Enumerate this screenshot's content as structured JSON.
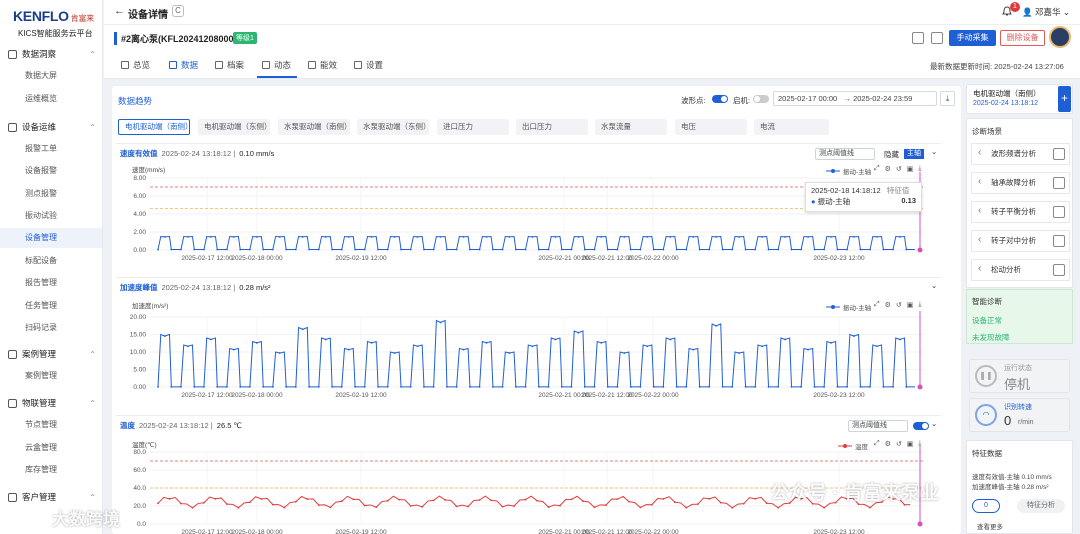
{
  "brand": {
    "logo": "KENFLO",
    "logo_cn": "肯富来",
    "platform": "KICS智能服务云平台"
  },
  "sidebar": {
    "groups": [
      {
        "label": "数据洞察",
        "items": [
          "数据大屏",
          "运维概览"
        ]
      },
      {
        "label": "设备运维",
        "items": [
          "报警工单",
          "设备报警",
          "测点报警",
          "振动试验",
          "设备管理",
          "标配设备",
          "报告管理",
          "任务管理",
          "扫码记录"
        ]
      },
      {
        "label": "案例管理",
        "items": [
          "案例管理"
        ]
      },
      {
        "label": "物联管理",
        "items": [
          "节点管理",
          "云盒管理",
          "库存管理"
        ]
      },
      {
        "label": "客户管理",
        "items": []
      }
    ],
    "active": "设备管理"
  },
  "header": {
    "back": "←",
    "title": "设备详情",
    "notif_count": "1",
    "user": "邓嘉华"
  },
  "device": {
    "name": "#2离心泵(KFL202412080008)",
    "status": "等级1",
    "btn_collect": "手动采集",
    "btn_delete": "删除设备"
  },
  "tabs": [
    {
      "label": "总览"
    },
    {
      "label": "数据"
    },
    {
      "label": "档案"
    },
    {
      "label": "动态"
    },
    {
      "label": "能效"
    },
    {
      "label": "设置"
    }
  ],
  "updated": "最新数据更新时间: 2025-02-24 13:27:06",
  "trend": {
    "title": "数据趋势",
    "waveform_label": "波形点:",
    "shutdown_label": "启机:",
    "date_from": "2025-02-17 00:00",
    "date_to": "2025-02-24 23:59",
    "arrow": "→",
    "chips": [
      "电机驱动端（南侧）",
      "电机驱动端（东侧）",
      "水泵驱动端（南侧）",
      "水泵驱动端（东侧）",
      "进口压力",
      "出口压力",
      "水泵流量",
      "电压",
      "电流"
    ]
  },
  "cards": [
    {
      "title": "速度有效值",
      "time": "2025-02-24 13:18:12",
      "value": "0.10 mm/s",
      "threshold": "测点阈值线",
      "hide": "隐藏",
      "main": "主轴",
      "yunit": "速度(mm/s)",
      "legend": "振动-主轴",
      "yticks": [
        "8.00",
        "6.00",
        "4.00",
        "2.00",
        "0.00"
      ]
    },
    {
      "title": "加速度峰值",
      "time": "2025-02-24 13:18:12",
      "value": "0.28 m/s²",
      "yunit": "加速度(m/s²)",
      "legend": "振动-主轴",
      "yticks": [
        "20.00",
        "15.00",
        "10.00",
        "5.00",
        "0.00"
      ]
    },
    {
      "title": "温度",
      "time": "2025-02-24 13:18:12",
      "value": "26.5 ℃",
      "threshold": "测点阈值线",
      "yunit": "温度(℃)",
      "legend": "温度",
      "yticks": [
        "80.0",
        "60.0",
        "40.0",
        "20.0",
        "0.0"
      ]
    }
  ],
  "xticks": [
    "2025-02-17 12:00",
    "2025-02-18 00:00",
    "2025-02-19 12:00",
    "2025-02-21 00:00",
    "2025-02-21 12:00",
    "2025-02-22 00:00",
    "2025-02-23 12:00"
  ],
  "tooltip": {
    "time": "2025-02-18 14:18:12",
    "label": "特征值",
    "series": "振动-主轴",
    "value": "0.13"
  },
  "right": {
    "sensor": "电机驱动端（南侧）",
    "sensor_time": "2025-02-24 13:18:12",
    "scene_title": "诊断场景",
    "analyses": [
      "波形频谱分析",
      "轴承故障分析",
      "转子平衡分析",
      "转子对中分析",
      "松动分析"
    ],
    "smart_title": "智能诊断",
    "smart_status": "设备正常",
    "smart_fault": "未发现故障",
    "run_label": "运行状态",
    "run_value": "停机",
    "speed_label": "识别转速",
    "speed_value": "0",
    "speed_unit": "r/min",
    "feature_title": "特征数据",
    "feature_row1": "速度有效值-主轴  0.10 mm/s",
    "feature_row2": "加速度峰值-主轴 0.28 m/s²",
    "more": "查看更多",
    "feature_btn": "特征分析",
    "feature_num": "0"
  },
  "chart_data": [
    {
      "type": "line",
      "title": "速度有效值",
      "ylabel": "速度(mm/s)",
      "ylim": [
        0,
        8
      ],
      "series": [
        {
          "name": "振动-主轴",
          "pattern": "periodic step between ~0.0 and ~1.5"
        }
      ],
      "thresholds": [
        7.0,
        4.5
      ]
    },
    {
      "type": "line",
      "title": "加速度峰值",
      "ylabel": "加速度(m/s²)",
      "ylim": [
        0,
        20
      ],
      "series": [
        {
          "name": "振动-主轴",
          "pattern": "periodic step between ~0.0 and ~10-15"
        }
      ]
    },
    {
      "type": "line",
      "title": "温度",
      "ylabel": "温度(℃)",
      "ylim": [
        0,
        80
      ],
      "series": [
        {
          "name": "温度",
          "pattern": "oscillating ~22-30"
        }
      ],
      "thresholds": [
        70,
        40
      ]
    }
  ],
  "watermark": {
    "left": "大数跨境",
    "right": "公众号 · 肯富来泵业"
  },
  "colors": {
    "accent": "#1f5fd6",
    "danger": "#e05b5b",
    "ok": "#2bb673"
  }
}
